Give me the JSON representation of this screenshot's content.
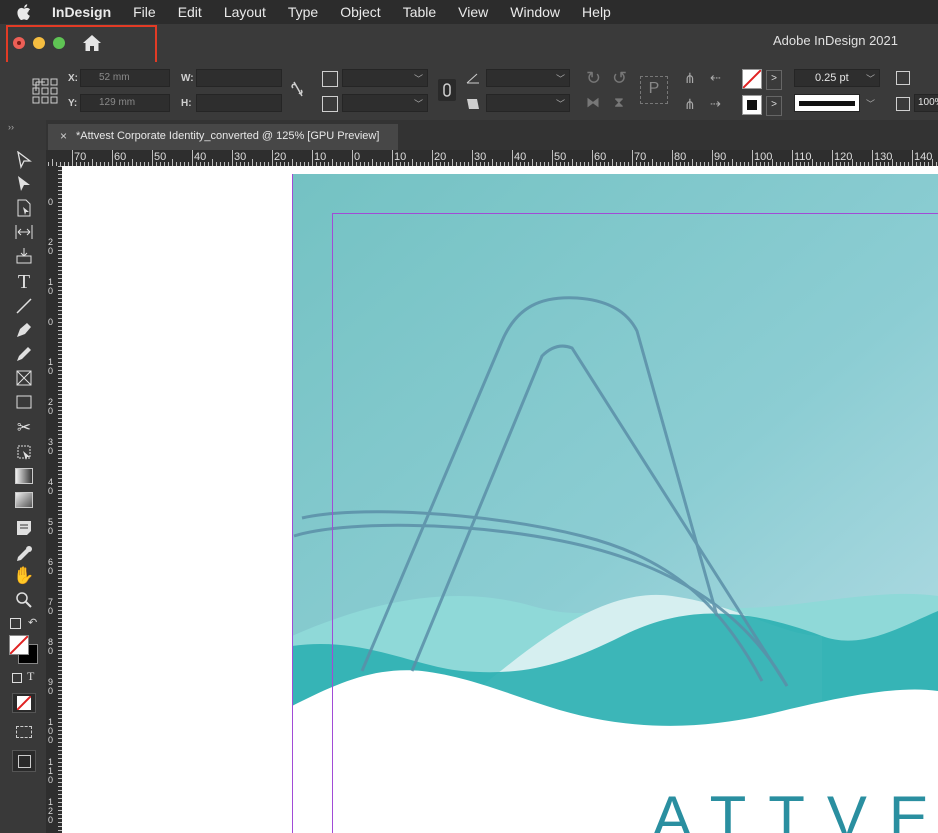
{
  "menubar": {
    "app": "InDesign",
    "items": [
      "File",
      "Edit",
      "Layout",
      "Type",
      "Object",
      "Table",
      "View",
      "Window",
      "Help"
    ]
  },
  "window": {
    "title": "Adobe InDesign 2021"
  },
  "control_panel": {
    "x_label": "X:",
    "x_value": "52 mm",
    "y_label": "Y:",
    "y_value": "129 mm",
    "w_label": "W:",
    "h_label": "H:",
    "stroke_weight": "0.25 pt",
    "zoom_partial": "100%"
  },
  "document_tab": {
    "close": "×",
    "title": "*Attvest Corporate Identity_converted @ 125% [GPU Preview]"
  },
  "ruler": {
    "horizontal": [
      "70",
      "60",
      "50",
      "40",
      "30",
      "20",
      "10",
      "0",
      "10",
      "20",
      "30",
      "40",
      "50",
      "60",
      "70",
      "80",
      "90",
      "100",
      "110",
      "120",
      "130",
      "140"
    ],
    "vertical": [
      "0",
      "2\n0",
      "1\n0",
      "0",
      "1\n0",
      "2\n0",
      "3\n0",
      "4\n0",
      "5\n0",
      "6\n0",
      "7\n0",
      "8\n0",
      "9\n0",
      "1\n0\n0",
      "1\n1\n0",
      "1\n2\n0"
    ]
  },
  "canvas": {
    "brand_text": "ATTVE",
    "colors": {
      "sky_top": "#7cc4c6",
      "sky_bottom": "#a6d5de",
      "wave_teal": "#2fb1b3",
      "wave_light": "#8fd9d8",
      "wave_pale": "#d6eff0",
      "outline": "#5b8fa8",
      "margin_guide": "#a14bd6",
      "brand": "#2a8fa0"
    }
  },
  "colors": {
    "highlight_box": "#e23b25",
    "traffic_red": "#ed5f56",
    "traffic_yellow": "#f5bd40",
    "traffic_green": "#5fc454"
  }
}
